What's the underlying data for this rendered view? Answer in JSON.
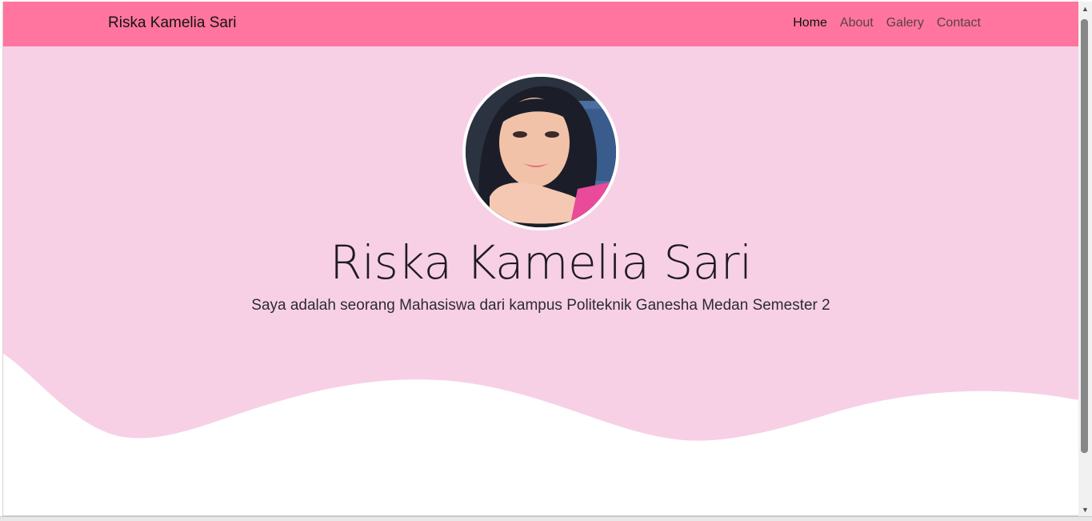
{
  "navbar": {
    "brand": "Riska Kamelia Sari",
    "links": [
      {
        "label": "Home",
        "active": true
      },
      {
        "label": "About",
        "active": false
      },
      {
        "label": "Galery",
        "active": false
      },
      {
        "label": "Contact",
        "active": false
      }
    ],
    "background": "#ff759f"
  },
  "hero": {
    "name": "Riska Kamelia Sari",
    "subtitle": "Saya adalah seorang Mahasiswa dari kampus Politeknik Ganesha Medan Semester 2",
    "background": "#f7d0e6"
  },
  "scrollbar": {
    "up_icon": "▲",
    "down_icon": "▼"
  }
}
